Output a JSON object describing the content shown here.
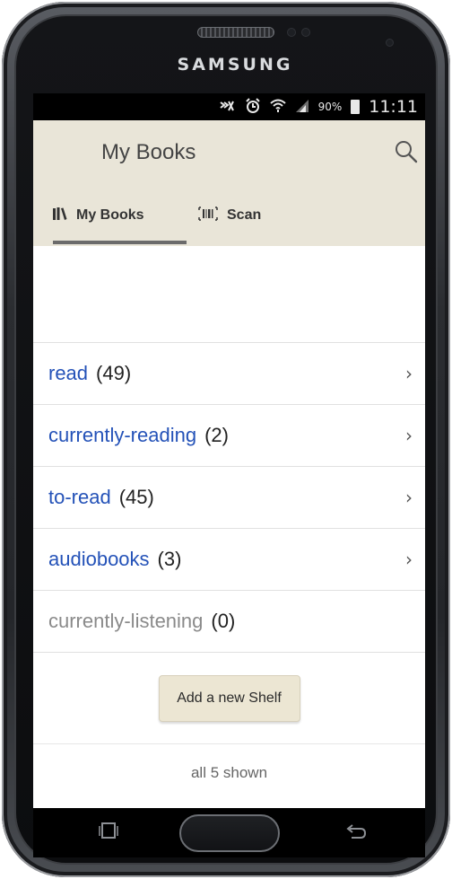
{
  "device": {
    "brand": "SAMSUNG"
  },
  "status_bar": {
    "battery": "90%",
    "time": "11:11",
    "icons": [
      "mute-icon",
      "alarm-icon",
      "wifi-icon",
      "signal-icon",
      "battery-icon"
    ]
  },
  "app_bar": {
    "title": "My Books",
    "search_icon": "search-icon"
  },
  "tabs": [
    {
      "label": "My Books",
      "icon": "bookshelf-icon",
      "selected": true
    },
    {
      "label": "Scan",
      "icon": "barcode-icon",
      "selected": false
    }
  ],
  "shelves": [
    {
      "name": "read",
      "count": "(49)",
      "enabled": true
    },
    {
      "name": "currently-reading",
      "count": "(2)",
      "enabled": true
    },
    {
      "name": "to-read",
      "count": "(45)",
      "enabled": true
    },
    {
      "name": "audiobooks",
      "count": "(3)",
      "enabled": true
    },
    {
      "name": "currently-listening",
      "count": "(0)",
      "enabled": false
    }
  ],
  "actions": {
    "add_shelf": "Add a new Shelf"
  },
  "footer": {
    "text": "all 5 shown"
  },
  "colors": {
    "app_bar_bg": "#e9e5d8",
    "link_blue": "#2452b8",
    "disabled_gray": "#8a8a8a",
    "button_bg": "#ece6d3"
  }
}
